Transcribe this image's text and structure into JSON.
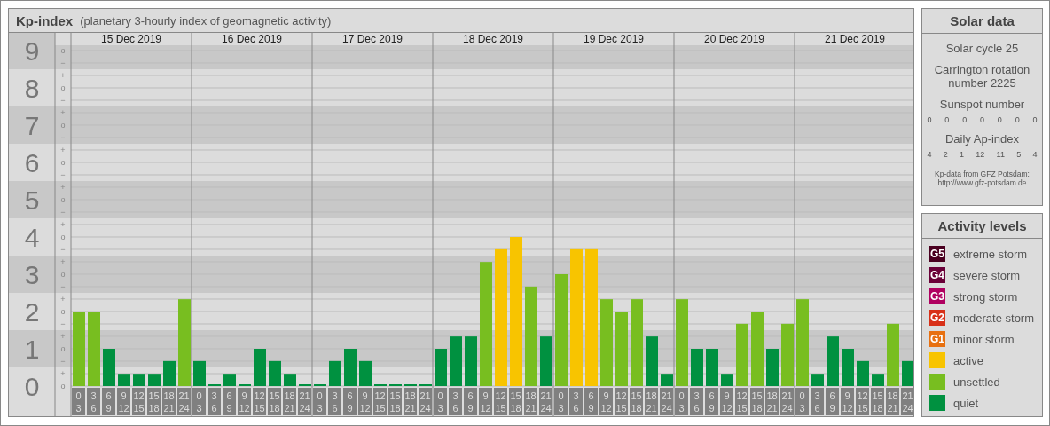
{
  "header": {
    "title": "Kp-index",
    "subtitle": "(planetary 3-hourly index of geomagnetic activity)"
  },
  "levels": [
    {
      "label": "9",
      "marks": [
        "o",
        "−"
      ]
    },
    {
      "label": "8",
      "marks": [
        "+",
        "o",
        "−"
      ]
    },
    {
      "label": "7",
      "marks": [
        "+",
        "o",
        "−"
      ]
    },
    {
      "label": "6",
      "marks": [
        "+",
        "o",
        "−"
      ]
    },
    {
      "label": "5",
      "marks": [
        "+",
        "o",
        "−"
      ]
    },
    {
      "label": "4",
      "marks": [
        "+",
        "o",
        "−"
      ]
    },
    {
      "label": "3",
      "marks": [
        "+",
        "o",
        "−"
      ]
    },
    {
      "label": "2",
      "marks": [
        "+",
        "o",
        "−"
      ]
    },
    {
      "label": "1",
      "marks": [
        "+",
        "o",
        "−"
      ]
    },
    {
      "label": "0",
      "marks": [
        "+",
        "o"
      ]
    }
  ],
  "days": [
    {
      "date": "15 Dec 2019",
      "intervals": [
        [
          "0",
          "3"
        ],
        [
          "3",
          "6"
        ],
        [
          "6",
          "9"
        ],
        [
          "9",
          "12"
        ],
        [
          "12",
          "15"
        ],
        [
          "15",
          "18"
        ],
        [
          "18",
          "21"
        ],
        [
          "21",
          "24"
        ]
      ]
    },
    {
      "date": "16 Dec 2019",
      "intervals": [
        [
          "0",
          "3"
        ],
        [
          "3",
          "6"
        ],
        [
          "6",
          "9"
        ],
        [
          "9",
          "12"
        ],
        [
          "12",
          "15"
        ],
        [
          "15",
          "18"
        ],
        [
          "18",
          "21"
        ],
        [
          "21",
          "24"
        ]
      ]
    },
    {
      "date": "17 Dec 2019",
      "intervals": [
        [
          "0",
          "3"
        ],
        [
          "3",
          "6"
        ],
        [
          "6",
          "9"
        ],
        [
          "9",
          "12"
        ],
        [
          "12",
          "15"
        ],
        [
          "15",
          "18"
        ],
        [
          "18",
          "21"
        ],
        [
          "21",
          "24"
        ]
      ]
    },
    {
      "date": "18 Dec 2019",
      "intervals": [
        [
          "0",
          "3"
        ],
        [
          "3",
          "6"
        ],
        [
          "6",
          "9"
        ],
        [
          "9",
          "12"
        ],
        [
          "12",
          "15"
        ],
        [
          "15",
          "18"
        ],
        [
          "18",
          "21"
        ],
        [
          "21",
          "24"
        ]
      ]
    },
    {
      "date": "19 Dec 2019",
      "intervals": [
        [
          "0",
          "3"
        ],
        [
          "3",
          "6"
        ],
        [
          "6",
          "9"
        ],
        [
          "9",
          "12"
        ],
        [
          "12",
          "15"
        ],
        [
          "15",
          "18"
        ],
        [
          "18",
          "21"
        ],
        [
          "21",
          "24"
        ]
      ]
    },
    {
      "date": "20 Dec 2019",
      "intervals": [
        [
          "0",
          "3"
        ],
        [
          "3",
          "6"
        ],
        [
          "6",
          "9"
        ],
        [
          "9",
          "12"
        ],
        [
          "12",
          "15"
        ],
        [
          "15",
          "18"
        ],
        [
          "18",
          "21"
        ],
        [
          "21",
          "24"
        ]
      ]
    },
    {
      "date": "21 Dec 2019",
      "intervals": [
        [
          "0",
          "3"
        ],
        [
          "3",
          "6"
        ],
        [
          "6",
          "9"
        ],
        [
          "9",
          "12"
        ],
        [
          "12",
          "15"
        ],
        [
          "15",
          "18"
        ],
        [
          "18",
          "21"
        ],
        [
          "21",
          "24"
        ]
      ]
    }
  ],
  "chart_data": {
    "type": "bar",
    "ylim": [
      0,
      9
    ],
    "yticks": [
      0,
      1,
      2,
      3,
      4,
      5,
      6,
      7,
      8,
      9
    ],
    "grid": true,
    "bands": [
      {
        "axis": "y",
        "from": 0.5,
        "to": 1.5
      },
      {
        "axis": "y",
        "from": 2.5,
        "to": 3.5
      },
      {
        "axis": "y",
        "from": 4.5,
        "to": 5.5
      },
      {
        "axis": "y",
        "from": 6.5,
        "to": 7.5
      },
      {
        "axis": "y",
        "from": 8.5,
        "to": 9.5
      }
    ],
    "series": [
      {
        "color": "#009140",
        "values": [
          null,
          null,
          1,
          0.33,
          0.33,
          0.33,
          0.67,
          null,
          0.67,
          0,
          0.33,
          0,
          1,
          0.67,
          0.33,
          0,
          0,
          0.67,
          1,
          0.67,
          0,
          0,
          0,
          0,
          1,
          1.33,
          1.33,
          null,
          null,
          null,
          null,
          1.33,
          null,
          null,
          null,
          null,
          null,
          null,
          1.33,
          0.33,
          null,
          1,
          1,
          0.33,
          null,
          null,
          1,
          null,
          null,
          0.33,
          1.33,
          1,
          0.67,
          0.33,
          null,
          0.67
        ]
      },
      {
        "color": "#78be20",
        "values": [
          2,
          2,
          null,
          null,
          null,
          null,
          null,
          2.33,
          null,
          null,
          null,
          null,
          null,
          null,
          null,
          null,
          null,
          null,
          null,
          null,
          null,
          null,
          null,
          null,
          null,
          null,
          null,
          3.33,
          null,
          null,
          2.67,
          null,
          3,
          null,
          null,
          2.33,
          2,
          2.33,
          null,
          null,
          2.33,
          null,
          null,
          null,
          1.67,
          2,
          null,
          1.67,
          2.33,
          null,
          null,
          null,
          null,
          null,
          1.67,
          null
        ]
      },
      {
        "color": "#f8c400",
        "values": [
          null,
          null,
          null,
          null,
          null,
          null,
          null,
          null,
          null,
          null,
          null,
          null,
          null,
          null,
          null,
          null,
          null,
          null,
          null,
          null,
          null,
          null,
          null,
          null,
          null,
          null,
          null,
          null,
          3.67,
          4,
          null,
          null,
          null,
          3.67,
          3.67,
          null,
          null,
          null,
          null,
          null,
          null,
          null,
          null,
          null,
          null,
          null,
          null,
          null,
          null,
          null,
          null,
          null,
          null,
          null,
          null,
          null
        ]
      }
    ]
  },
  "solar": {
    "title": "Solar data",
    "cycle": "Solar cycle 25",
    "carrington": "Carrington rotation number 2225",
    "sunspot_title": "Sunspot number",
    "sunspot_values": [
      "0",
      "0",
      "0",
      "0",
      "0",
      "0",
      "0"
    ],
    "ap_title": "Daily Ap-index",
    "ap_values": [
      "4",
      "2",
      "1",
      "12",
      "11",
      "5",
      "4"
    ],
    "source": "Kp-data from GFZ Potsdam:",
    "source_url": "http://www.gfz-potsdam.de"
  },
  "legend": {
    "title": "Activity levels",
    "items": [
      {
        "badge": "G5",
        "label": "extreme storm",
        "color": "#4a0020"
      },
      {
        "badge": "G4",
        "label": "severe storm",
        "color": "#6a0038"
      },
      {
        "badge": "G3",
        "label": "strong storm",
        "color": "#b00060"
      },
      {
        "badge": "G2",
        "label": "moderate storm",
        "color": "#d83018"
      },
      {
        "badge": "G1",
        "label": "minor storm",
        "color": "#e87010"
      },
      {
        "label": "active",
        "color": "#f8c400"
      },
      {
        "label": "unsettled",
        "color": "#78be20"
      },
      {
        "label": "quiet",
        "color": "#009140"
      }
    ]
  }
}
